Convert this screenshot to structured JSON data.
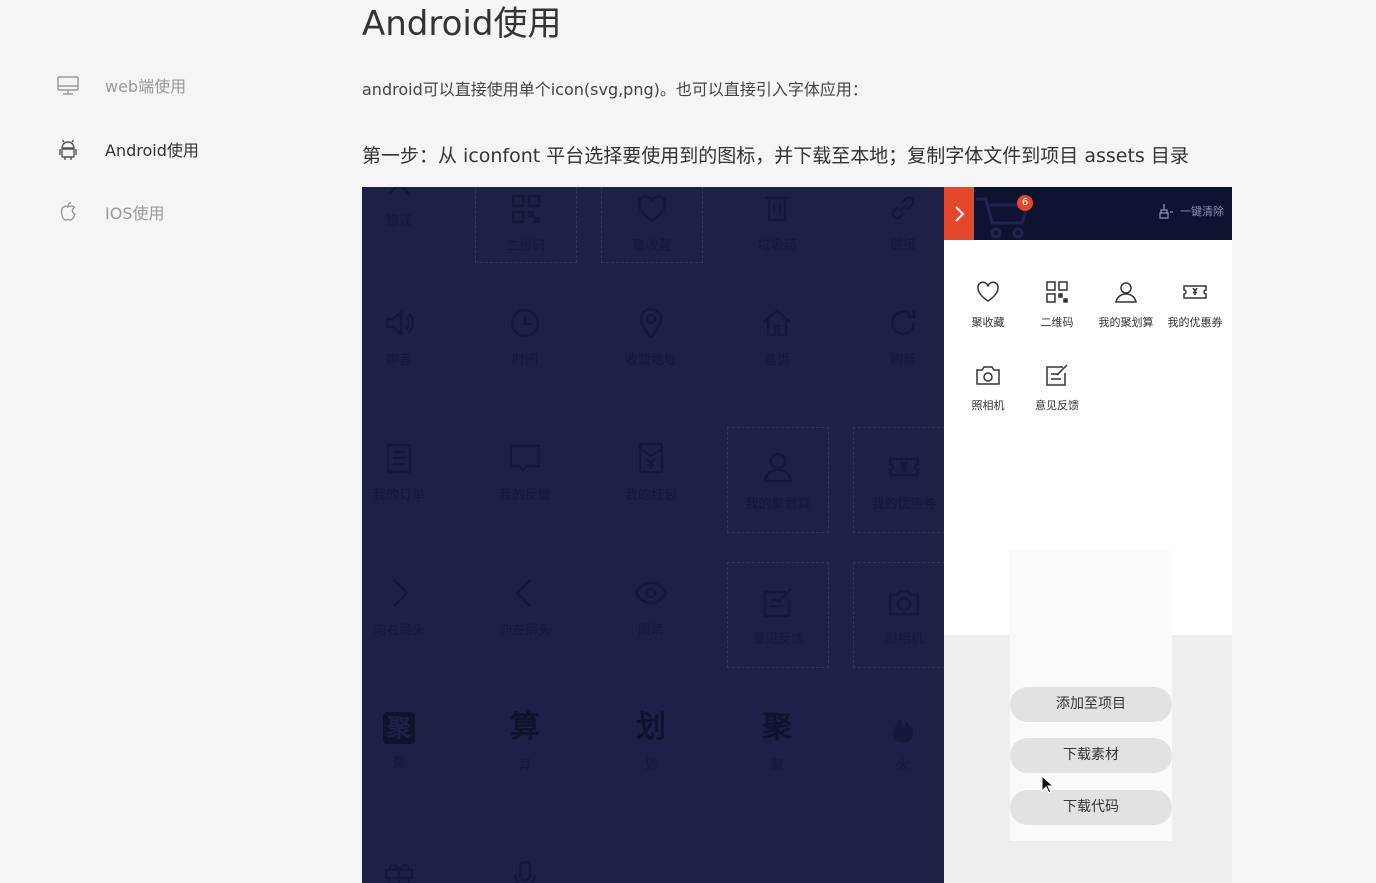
{
  "sidebar": {
    "items": [
      {
        "label": "web端使用",
        "icon": "monitor-icon"
      },
      {
        "label": "Android使用",
        "icon": "android-icon"
      },
      {
        "label": "IOS使用",
        "icon": "apple-icon"
      }
    ]
  },
  "main": {
    "title": "Android使用",
    "description": "android可以直接使用单个icon(svg,png)。也可以直接引入字体应用：",
    "step1": "第一步：从 iconfont 平台选择要使用到的图标，并下载至本地；复制字体文件到项目 assets 目录"
  },
  "icon_grid": {
    "rows": [
      [
        {
          "label": "错误",
          "icon": "close-icon"
        },
        {
          "label": "二维码",
          "icon": "qrcode-icon"
        },
        {
          "label": "聚收藏",
          "icon": "heart-icon"
        },
        {
          "label": "垃圾箱",
          "icon": "trash-icon"
        },
        {
          "label": "链接",
          "icon": "link-icon"
        }
      ],
      [
        {
          "label": "声音",
          "icon": "sound-icon"
        },
        {
          "label": "时间",
          "icon": "clock-icon"
        },
        {
          "label": "收货地址",
          "icon": "location-icon"
        },
        {
          "label": "首页",
          "icon": "home-icon"
        },
        {
          "label": "刷新",
          "icon": "refresh-icon"
        }
      ],
      [
        {
          "label": "我的订单",
          "icon": "order-icon"
        },
        {
          "label": "我的反馈",
          "icon": "feedback-icon"
        },
        {
          "label": "我的红包",
          "icon": "red-packet-icon"
        },
        {
          "label": "我的聚划算",
          "icon": "user-icon"
        },
        {
          "label": "我的优惠券",
          "icon": "coupon-icon"
        }
      ],
      [
        {
          "label": "向右箭头",
          "icon": "arrow-right-icon"
        },
        {
          "label": "向左箭头",
          "icon": "arrow-left-icon"
        },
        {
          "label": "眼睛",
          "icon": "eye-icon"
        },
        {
          "label": "意见反馈",
          "icon": "edit-icon"
        },
        {
          "label": "照相机",
          "icon": "camera-icon"
        }
      ],
      [
        {
          "label": "聚",
          "glyph": "聚"
        },
        {
          "label": "算",
          "glyph": "算"
        },
        {
          "label": "划",
          "glyph": "划"
        },
        {
          "label": "聚",
          "glyph": "聚"
        },
        {
          "label": "火",
          "icon": "fire-icon"
        }
      ]
    ]
  },
  "cart": {
    "badge": "6",
    "clear_label": "一键清除",
    "items": [
      {
        "label": "聚收藏",
        "icon": "heart-icon"
      },
      {
        "label": "二维码",
        "icon": "qrcode-icon"
      },
      {
        "label": "我的聚划算",
        "icon": "user-icon"
      },
      {
        "label": "我的优惠券",
        "icon": "coupon-icon"
      },
      {
        "label": "照相机",
        "icon": "camera-icon"
      },
      {
        "label": "意见反馈",
        "icon": "edit-icon"
      }
    ],
    "actions": {
      "add_to_project": "添加至项目",
      "download_assets": "下载素材",
      "download_code": "下载代码"
    }
  },
  "colors": {
    "grid_background": "#1e2147",
    "cart_header": "#0d1330",
    "accent_red": "#e4472a"
  }
}
